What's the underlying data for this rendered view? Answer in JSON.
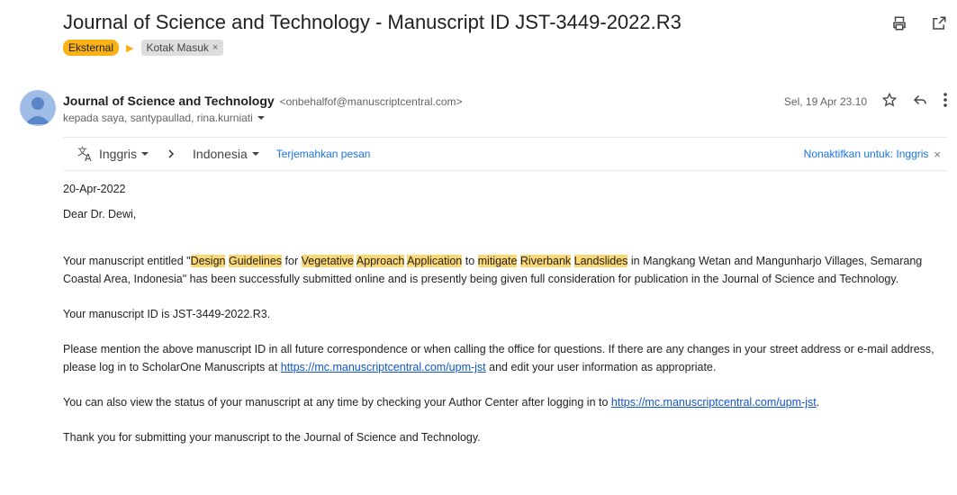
{
  "email": {
    "subject": "Journal of Science and Technology - Manuscript ID JST-3449-2022.R3",
    "labels": {
      "external": "Eksternal",
      "inbox": "Kotak Masuk",
      "remove": "×"
    },
    "sender": {
      "name": "Journal of Science and Technology",
      "email": "<onbehalfof@manuscriptcentral.com>",
      "recipients": "kepada saya, santypaullad, rina.kurniati"
    },
    "date": "Sel, 19 Apr 23.10"
  },
  "translate": {
    "from": "Inggris",
    "to": "Indonesia",
    "translate_label": "Terjemahkan pesan",
    "disable_label": "Nonaktifkan untuk: Inggris",
    "close": "×"
  },
  "body": {
    "date": "20-Apr-2022",
    "greeting": "Dear Dr. Dewi,",
    "p1": {
      "pre": "Your manuscript entitled \"",
      "t1": "Design",
      "t2": "Guidelines",
      "s1": " for ",
      "t3": "Vegetative",
      "s2": " ",
      "t4": "Approach",
      "s3": " ",
      "t5": "Application",
      "s4": " to ",
      "t6": "mitigate",
      "s5": " ",
      "t7": "Riverbank",
      "s6": " ",
      "t8": "Landslides",
      "post": " in Mangkang Wetan and Mangunharjo Villages, Semarang Coastal Area, Indonesia\" has been successfully submitted online and is presently being given full consideration for publication in the Journal of Science and Technology."
    },
    "p2": "Your manuscript ID is JST-3449-2022.R3.",
    "p3": {
      "pre": "Please mention the above manuscript ID in all future correspondence or when calling the office for questions. If there are any changes in your street address or e-mail address, please log in to ScholarOne Manuscripts at ",
      "link": "https://mc.manuscriptcentral.com/upm-jst",
      "post": " and edit your user information as appropriate."
    },
    "p4": {
      "pre": "You can also view the status of your manuscript at any time by checking your Author Center after logging in to ",
      "link": "https://mc.manuscriptcentral.com/upm-jst",
      "post": "."
    },
    "p5": "Thank you for submitting your manuscript to the Journal of Science and Technology."
  }
}
